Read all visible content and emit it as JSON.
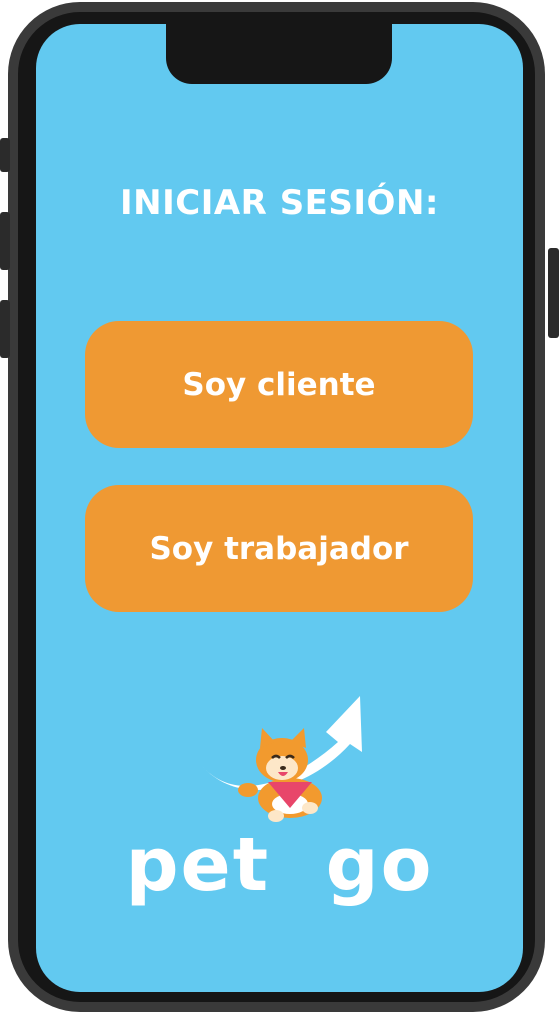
{
  "screen": {
    "title": "INICIAR SESIÓN:",
    "background_color": "#62c9f0"
  },
  "buttons": {
    "client_label": "Soy cliente",
    "worker_label": "Soy trabajador",
    "color": "#ef9933"
  },
  "logo": {
    "text": "pet  go",
    "icon": "shiba-dog-arrow-icon"
  }
}
